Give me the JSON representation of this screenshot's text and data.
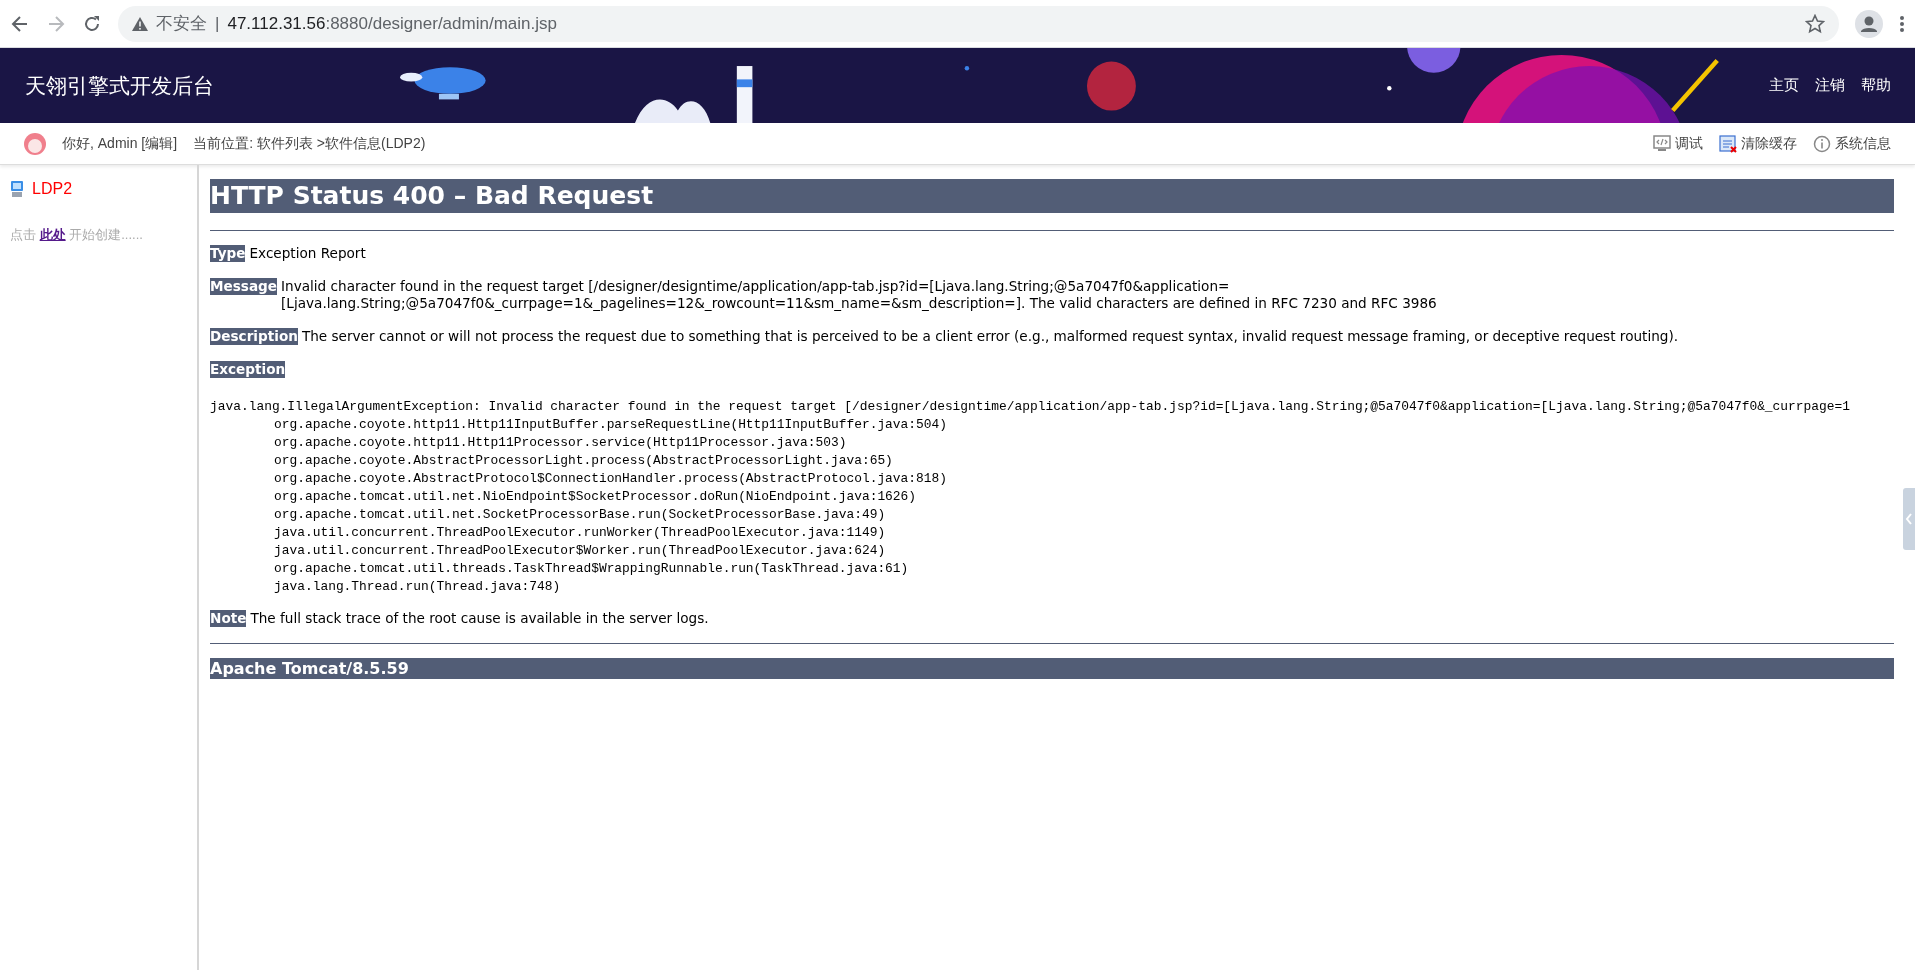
{
  "browser": {
    "security_label": "不安全",
    "separator": "|",
    "url_host": "47.112.31.56",
    "url_path": ":8880/designer/admin/main.jsp"
  },
  "header": {
    "title": "天翎引擎式开发后台",
    "nav": [
      "主页",
      "注销",
      "帮助"
    ]
  },
  "toolbar": {
    "greeting": "你好, Admin [编辑]",
    "breadcrumb": "当前位置: 软件列表 >软件信息(LDP2)",
    "tools": [
      {
        "kind": "debug",
        "label": "调试"
      },
      {
        "kind": "clear-cache",
        "label": "清除缓存"
      },
      {
        "kind": "info",
        "label": "系统信息"
      }
    ]
  },
  "sidebar": {
    "tree": [
      {
        "label": "LDP2"
      }
    ],
    "hint": {
      "before": "点击 ",
      "link": "此处",
      "after": " 开始创建......"
    }
  },
  "error": {
    "title": "HTTP Status 400 – Bad Request",
    "sections": [
      {
        "label": "Type",
        "text": "Exception Report"
      },
      {
        "label": "Message",
        "text": "Invalid character found in the request target [/designer/designtime/application/app-tab.jsp?id=[Ljava.lang.String;@5a7047f0&application=[Ljava.lang.String;@5a7047f0&_currpage=1&_pagelines=12&_rowcount=11&sm_name=&sm_description=]. The valid characters are defined in RFC 7230 and RFC 3986"
      },
      {
        "label": "Description",
        "text": "The server cannot or will not process the request due to something that is perceived to be a client error (e.g., malformed request syntax, invalid request message framing, or deceptive request routing)."
      },
      {
        "label": "Exception"
      }
    ],
    "stack_trace": [
      "java.lang.IllegalArgumentException: Invalid character found in the request target [/designer/designtime/application/app-tab.jsp?id=[Ljava.lang.String;@5a7047f0&application=[Ljava.lang.String;@5a7047f0&_currpage=1",
      "org.apache.coyote.http11.Http11InputBuffer.parseRequestLine(Http11InputBuffer.java:504)",
      "org.apache.coyote.http11.Http11Processor.service(Http11Processor.java:503)",
      "org.apache.coyote.AbstractProcessorLight.process(AbstractProcessorLight.java:65)",
      "org.apache.coyote.AbstractProtocol$ConnectionHandler.process(AbstractProtocol.java:818)",
      "org.apache.tomcat.util.net.NioEndpoint$SocketProcessor.doRun(NioEndpoint.java:1626)",
      "org.apache.tomcat.util.net.SocketProcessorBase.run(SocketProcessorBase.java:49)",
      "java.util.concurrent.ThreadPoolExecutor.runWorker(ThreadPoolExecutor.java:1149)",
      "java.util.concurrent.ThreadPoolExecutor$Worker.run(ThreadPoolExecutor.java:624)",
      "org.apache.tomcat.util.threads.TaskThread$WrappingRunnable.run(TaskThread.java:61)",
      "java.lang.Thread.run(Thread.java:748)"
    ],
    "note": {
      "label": "Note",
      "text": "The full stack trace of the root cause is available in the server logs."
    },
    "footer": "Apache Tomcat/8.5.59"
  }
}
